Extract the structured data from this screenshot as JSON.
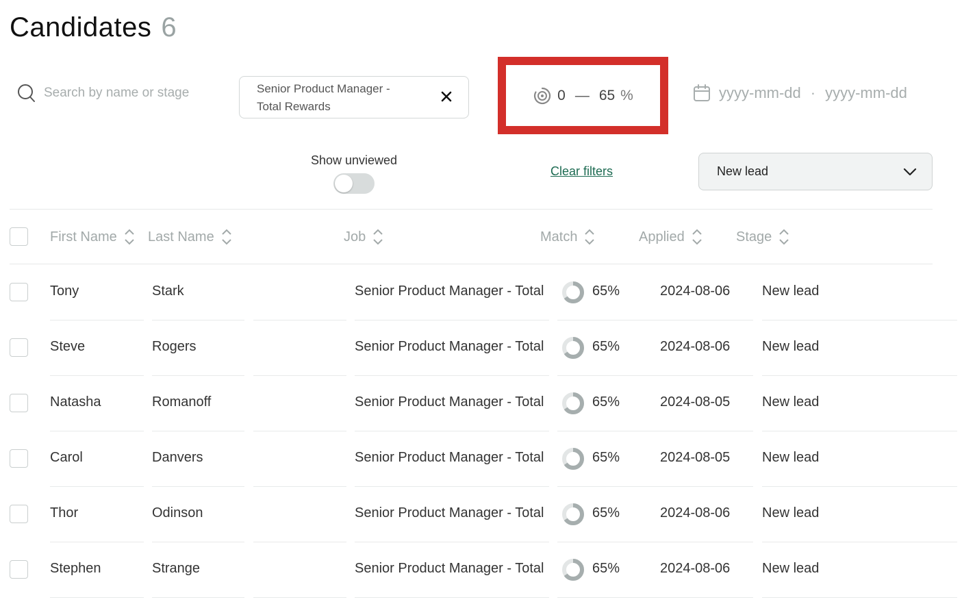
{
  "header": {
    "title": "Candidates",
    "count": "6"
  },
  "filters": {
    "search_placeholder": "Search by name or stage",
    "job_line1": "Senior Product Manager -",
    "job_line2": "Total Rewards",
    "match_min": "0",
    "match_separator": "—",
    "match_max": "65",
    "match_unit": "%",
    "date_start_placeholder": "yyyy-mm-dd",
    "date_separator": "·",
    "date_end_placeholder": "yyyy-mm-dd",
    "show_unviewed_label": "Show unviewed",
    "show_unviewed_on": false,
    "clear_filters_label": "Clear filters",
    "stage_selected": "New lead"
  },
  "table": {
    "columns": [
      "First Name",
      "Last Name",
      "Job",
      "Match",
      "Applied",
      "Stage"
    ],
    "rows": [
      {
        "first": "Tony",
        "last": "Stark",
        "job": "Senior Product Manager - Total",
        "match": "65%",
        "applied": "2024-08-06",
        "stage": "New lead"
      },
      {
        "first": "Steve",
        "last": "Rogers",
        "job": "Senior Product Manager - Total",
        "match": "65%",
        "applied": "2024-08-06",
        "stage": "New lead"
      },
      {
        "first": "Natasha",
        "last": "Romanoff",
        "job": "Senior Product Manager - Total",
        "match": "65%",
        "applied": "2024-08-05",
        "stage": "New lead"
      },
      {
        "first": "Carol",
        "last": "Danvers",
        "job": "Senior Product Manager - Total",
        "match": "65%",
        "applied": "2024-08-05",
        "stage": "New lead"
      },
      {
        "first": "Thor",
        "last": "Odinson",
        "job": "Senior Product Manager - Total",
        "match": "65%",
        "applied": "2024-08-06",
        "stage": "New lead"
      },
      {
        "first": "Stephen",
        "last": "Strange",
        "job": "Senior Product Manager - Total",
        "match": "65%",
        "applied": "2024-08-06",
        "stage": "New lead"
      }
    ]
  },
  "colors": {
    "highlight_border": "#d32f2a",
    "link": "#1d6b52",
    "donut_fill": "#a6aeae",
    "donut_track": "#e3e6e6"
  },
  "icons": {
    "search": "search-icon",
    "clear": "close-icon",
    "match": "match-gauge-icon",
    "date": "calendar-icon",
    "dropdown": "chevron-down-icon",
    "sort": "sort-icon"
  }
}
